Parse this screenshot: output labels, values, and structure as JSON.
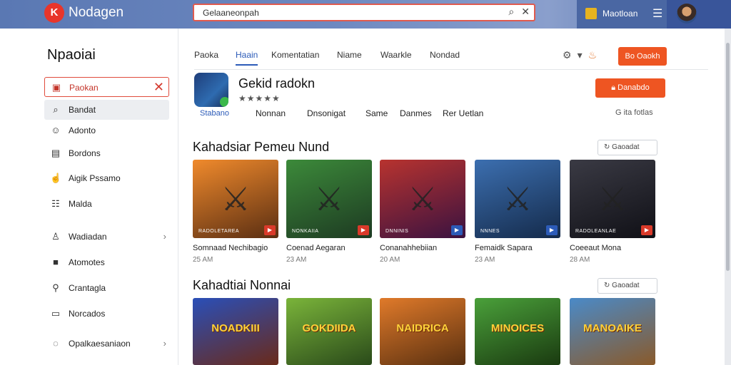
{
  "topbar": {
    "logo_letter": "K",
    "brand": "Nodagen",
    "search_value": "Gelaaneonpah",
    "user_name": "Maotloan"
  },
  "sidebar": {
    "title": "Npaoiai",
    "items": [
      {
        "label": "Paokan",
        "icon": "bag-icon"
      },
      {
        "label": "Bandat",
        "icon": "search-icon"
      },
      {
        "label": "Adonto",
        "icon": "smile-icon"
      },
      {
        "label": "Bordons",
        "icon": "list-icon"
      },
      {
        "label": "Aigik Pssamo",
        "icon": "hand-icon"
      },
      {
        "label": "Malda",
        "icon": "menu-icon"
      },
      {
        "label": "Wadiadan",
        "icon": "user-icon"
      },
      {
        "label": "Atomotes",
        "icon": "square-icon"
      },
      {
        "label": "Crantagla",
        "icon": "key-icon"
      },
      {
        "label": "Norcados",
        "icon": "monitor-icon"
      },
      {
        "label": "Opalkaesaniaon",
        "icon": "chat-icon"
      }
    ]
  },
  "tabs": [
    "Paoka",
    "Haain",
    "Komentatian",
    "Niame",
    "Waarkle",
    "Nondad"
  ],
  "buttons": {
    "top": "Bo Oaokh",
    "install": "Danabdo"
  },
  "app": {
    "title": "Gekid radokn",
    "stars": "★★★★★",
    "sub_label": "Stabano",
    "meta": [
      "Nonnan",
      "Dnsonigat",
      "Same",
      "Danmes",
      "Rer Uetlan"
    ],
    "meta_right": "G ita fotlas"
  },
  "section1": {
    "title": "Kahadsiar Pemeu Nund",
    "filter": "Gaoadat"
  },
  "section2": {
    "title": "Kahadtiai Nonnai",
    "filter": "Gaoadat"
  },
  "row1": [
    {
      "title": "Somnaad Nechibagio",
      "size": "25 AM",
      "caption": "RADOLETAREA",
      "colors": [
        "#f08a2c",
        "#5a2e12"
      ],
      "badge": "#d93a2a"
    },
    {
      "title": "Coenad Aegaran",
      "size": "23 AM",
      "caption": "NONKAIIA",
      "colors": [
        "#3c8a3a",
        "#1d3a22"
      ],
      "badge": "#d93a2a"
    },
    {
      "title": "Conanahhebiian",
      "size": "20 AM",
      "caption": "DNNINIS",
      "colors": [
        "#b8332f",
        "#3a1240"
      ],
      "badge": "#2c5bb8"
    },
    {
      "title": "Femaidk Sapara",
      "size": "23 AM",
      "caption": "NNNES",
      "colors": [
        "#3c6fb0",
        "#142a4a"
      ],
      "badge": "#2c5bb8"
    },
    {
      "title": "Coeeaut Mona",
      "size": "28 AM",
      "caption": "RADOLEANLAE",
      "colors": [
        "#3a3a44",
        "#101016"
      ],
      "badge": "#d93a2a"
    }
  ],
  "row2": [
    {
      "caption": "NOADKIII",
      "colors": [
        "#2a4fb8",
        "#6a2a1a"
      ]
    },
    {
      "caption": "GOKDIIDA",
      "colors": [
        "#7ab43a",
        "#2a4a1a"
      ]
    },
    {
      "caption": "NAIDRICA",
      "colors": [
        "#e07a2a",
        "#5a3010"
      ]
    },
    {
      "caption": "MINOICES",
      "colors": [
        "#4aa03a",
        "#1a3a10"
      ]
    },
    {
      "caption": "MANOAIKE",
      "colors": [
        "#4a8ac8",
        "#8a5a2a"
      ]
    }
  ]
}
